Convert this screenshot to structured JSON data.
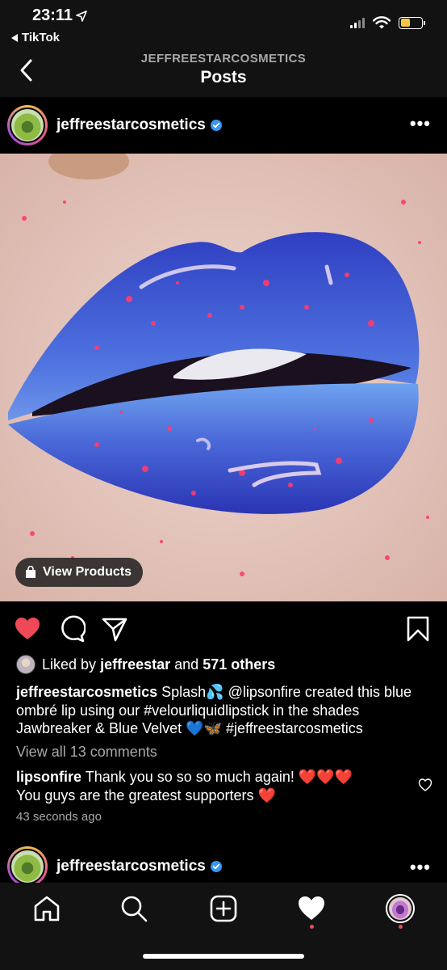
{
  "status_bar": {
    "time": "23:11",
    "back_app": "TikTok"
  },
  "nav": {
    "subtitle": "JEFFREESTARCOSMETICS",
    "title": "Posts"
  },
  "post": {
    "username": "jeffreestarcosmetics",
    "view_products_label": "View Products",
    "liked_by_prefix": "Liked by",
    "liked_by_user": "jeffreestar",
    "liked_by_and": "and",
    "liked_by_others": "571 others",
    "caption_user": "jeffreestarcosmetics",
    "caption_text_1": "Splash",
    "caption_emoji_1": "💦",
    "caption_text_2": "@lipsonfire created this blue ombré lip using our #velourliquidlipstick in the shades Jawbreaker & Blue Velvet",
    "caption_emoji_2": "💙🦋",
    "caption_text_3": "#jeffreestarcosmetics",
    "view_comments": "View all 13 comments",
    "comment_user": "lipsonfire",
    "comment_text_1": "Thank you so so so much again!",
    "comment_emoji_1": "❤️❤️❤️",
    "comment_text_2": "You guys are the greatest supporters",
    "comment_emoji_2": "❤️",
    "timestamp": "43 seconds ago"
  },
  "next_post": {
    "username": "jeffreestarcosmetics"
  },
  "colors": {
    "like_red": "#ed4956",
    "verified_blue": "#3897f0",
    "muted_text": "#a8a8a8"
  },
  "icons": [
    "back-chevron-icon",
    "verified-icon",
    "more-icon",
    "bag-icon",
    "heart-icon",
    "comment-icon",
    "share-icon",
    "bookmark-icon",
    "home-icon",
    "search-icon",
    "add-icon",
    "activity-icon",
    "profile-icon"
  ]
}
